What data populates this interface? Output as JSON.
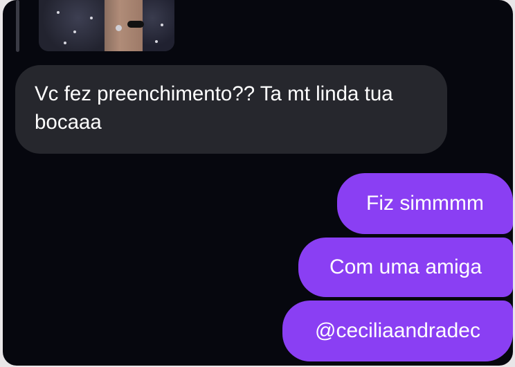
{
  "colors": {
    "background": "#06070e",
    "incoming_bubble": "#26272d",
    "outgoing_bubble": "#8a3ff3",
    "text": "#ffffff"
  },
  "story_reply": {
    "thumbnail_icon": "story-image"
  },
  "messages": [
    {
      "direction": "incoming",
      "text": "Vc fez preenchimento?? Ta mt linda tua bocaaa"
    },
    {
      "direction": "outgoing",
      "text": "Fiz simmmm"
    },
    {
      "direction": "outgoing",
      "text": "Com uma amiga"
    },
    {
      "direction": "outgoing",
      "text": "@ceciliaandradec"
    }
  ]
}
